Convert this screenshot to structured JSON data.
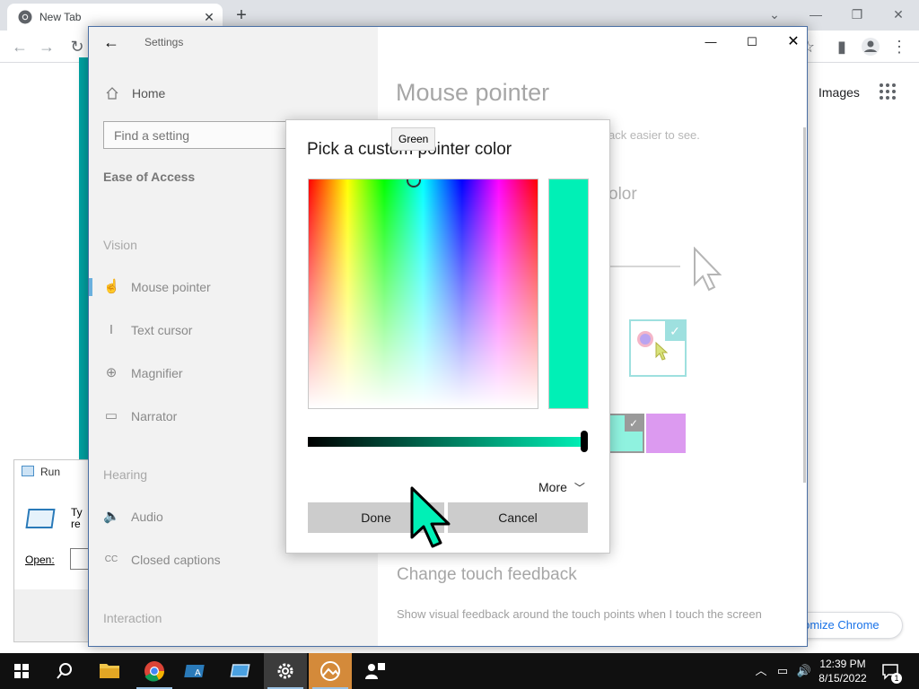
{
  "chrome": {
    "tab_title": "New Tab",
    "tab_close": "✕",
    "new_tab": "+",
    "images_link": "Images",
    "customize": "stomize Chrome"
  },
  "run": {
    "title": "Run",
    "desc": "Ty re",
    "open_label": "Open:"
  },
  "settings": {
    "title": "Settings",
    "nav": {
      "home": "Home",
      "search_placeholder": "Find a setting",
      "section": "Ease of Access",
      "groups": [
        "Vision",
        "Hearing",
        "Interaction"
      ],
      "vision_items": [
        {
          "label": "Mouse pointer",
          "icon": "mouse-pointer-icon"
        },
        {
          "label": "Text cursor",
          "icon": "text-cursor-icon"
        },
        {
          "label": "Magnifier",
          "icon": "magnifier-icon"
        },
        {
          "label": "Narrator",
          "icon": "narrator-icon"
        }
      ],
      "hearing_items": [
        {
          "label": "Audio",
          "icon": "audio-icon"
        },
        {
          "label": "Closed captions",
          "icon": "closed-captions-icon"
        }
      ]
    },
    "content": {
      "page_title": "Mouse pointer",
      "desc_fragment": "ack easier to see.",
      "color_heading_fragment": "olor",
      "touch_heading": "Change touch feedback",
      "touch_desc": "Show visual feedback around the touch points when I touch the screen"
    }
  },
  "picker": {
    "title": "Pick a custom pointer color",
    "tooltip": "Green",
    "selected_color": "#00f0b6",
    "more_label": "More",
    "done_label": "Done",
    "cancel_label": "Cancel"
  },
  "taskbar": {
    "time": "12:39 PM",
    "date": "8/15/2022",
    "notification_count": "1"
  },
  "colors": {
    "accent_teal": "#00a3a3",
    "custom_pointer": "#00f0b6",
    "swatch_teal": "#8ff2df",
    "swatch_purple": "#dc9af0"
  }
}
